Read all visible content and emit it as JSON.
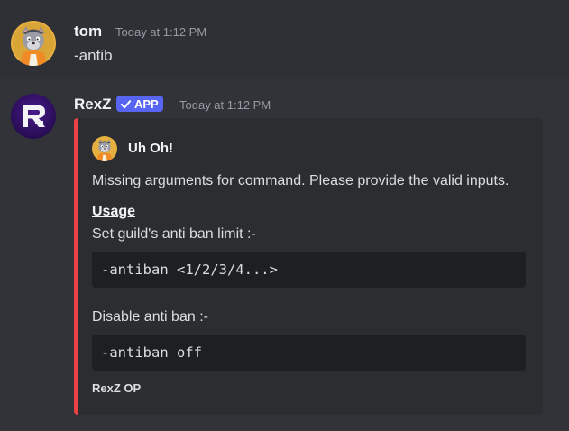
{
  "colors": {
    "background": "#313338",
    "hover_background": "#2e3035",
    "embed_background": "#2b2d31",
    "embed_accent": "#ed4245",
    "code_background": "#1e1f22",
    "app_badge": "#5865f2",
    "username": "#f2f3f5",
    "timestamp": "#949ba4"
  },
  "messages": [
    {
      "author": "tom",
      "avatar_icon": "cat-avatar-icon",
      "timestamp": "Today at 1:12 PM",
      "content": "-antib"
    },
    {
      "author": "RexZ",
      "avatar_icon": "rexz-logo-icon",
      "badge": {
        "icon": "checkmark-icon",
        "label": "APP"
      },
      "timestamp": "Today at 1:12 PM",
      "embed": {
        "author_icon": "cat-avatar-icon",
        "author_name": "Uh Oh!",
        "description": "Missing arguments for command. Please provide the valid inputs.",
        "usage_heading": "Usage",
        "line_1": "Set guild's anti ban limit :-",
        "code_1": "-antiban <1/2/3/4...>",
        "line_2": "Disable anti ban :-",
        "code_2": "-antiban off",
        "footer": "RexZ OP"
      }
    }
  ]
}
